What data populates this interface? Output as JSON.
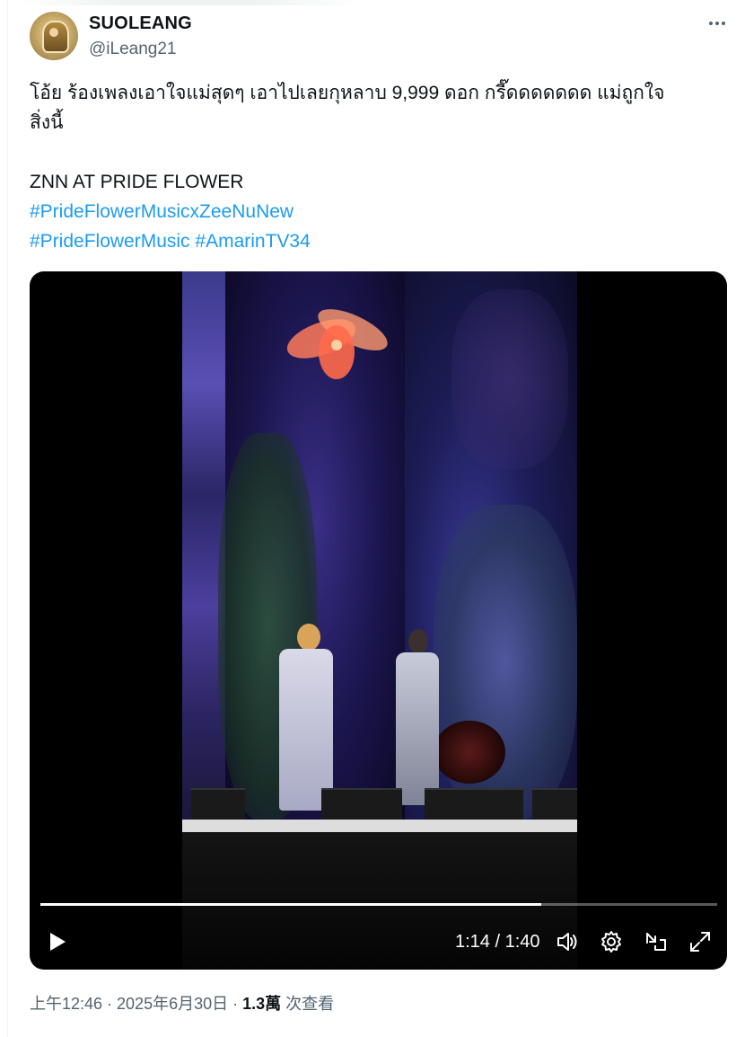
{
  "author": {
    "display_name": "SUOLEANG",
    "handle": "@iLeang21"
  },
  "tweet": {
    "line1": "โอ้ย ร้องเพลงเอาใจแม่สุดๆ เอาไปเลยกุหลาบ 9,999 ดอก กรี๊ดดดดดดด แม่ถูกใจ",
    "line2": "สิ่งนี้",
    "line3": "ZNN AT PRIDE FLOWER",
    "hashtags": [
      "#PrideFlowerMusicxZeeNuNew",
      "#PrideFlowerMusic",
      "#AmarinTV34"
    ]
  },
  "video": {
    "time": "1:14 / 1:40",
    "progress": 0.74
  },
  "meta": {
    "timestamp": "上午12:46 · 2025年6月30日 · ",
    "views_count": "1.3萬",
    "views_label": " 次查看"
  },
  "icons": [
    "more-icon",
    "play-icon",
    "volume-icon",
    "settings-icon",
    "pop-out-icon",
    "fullscreen-icon"
  ],
  "colors": {
    "link": "#1d9bf0",
    "secondary_text": "#536471",
    "primary_text": "#0f1419"
  }
}
